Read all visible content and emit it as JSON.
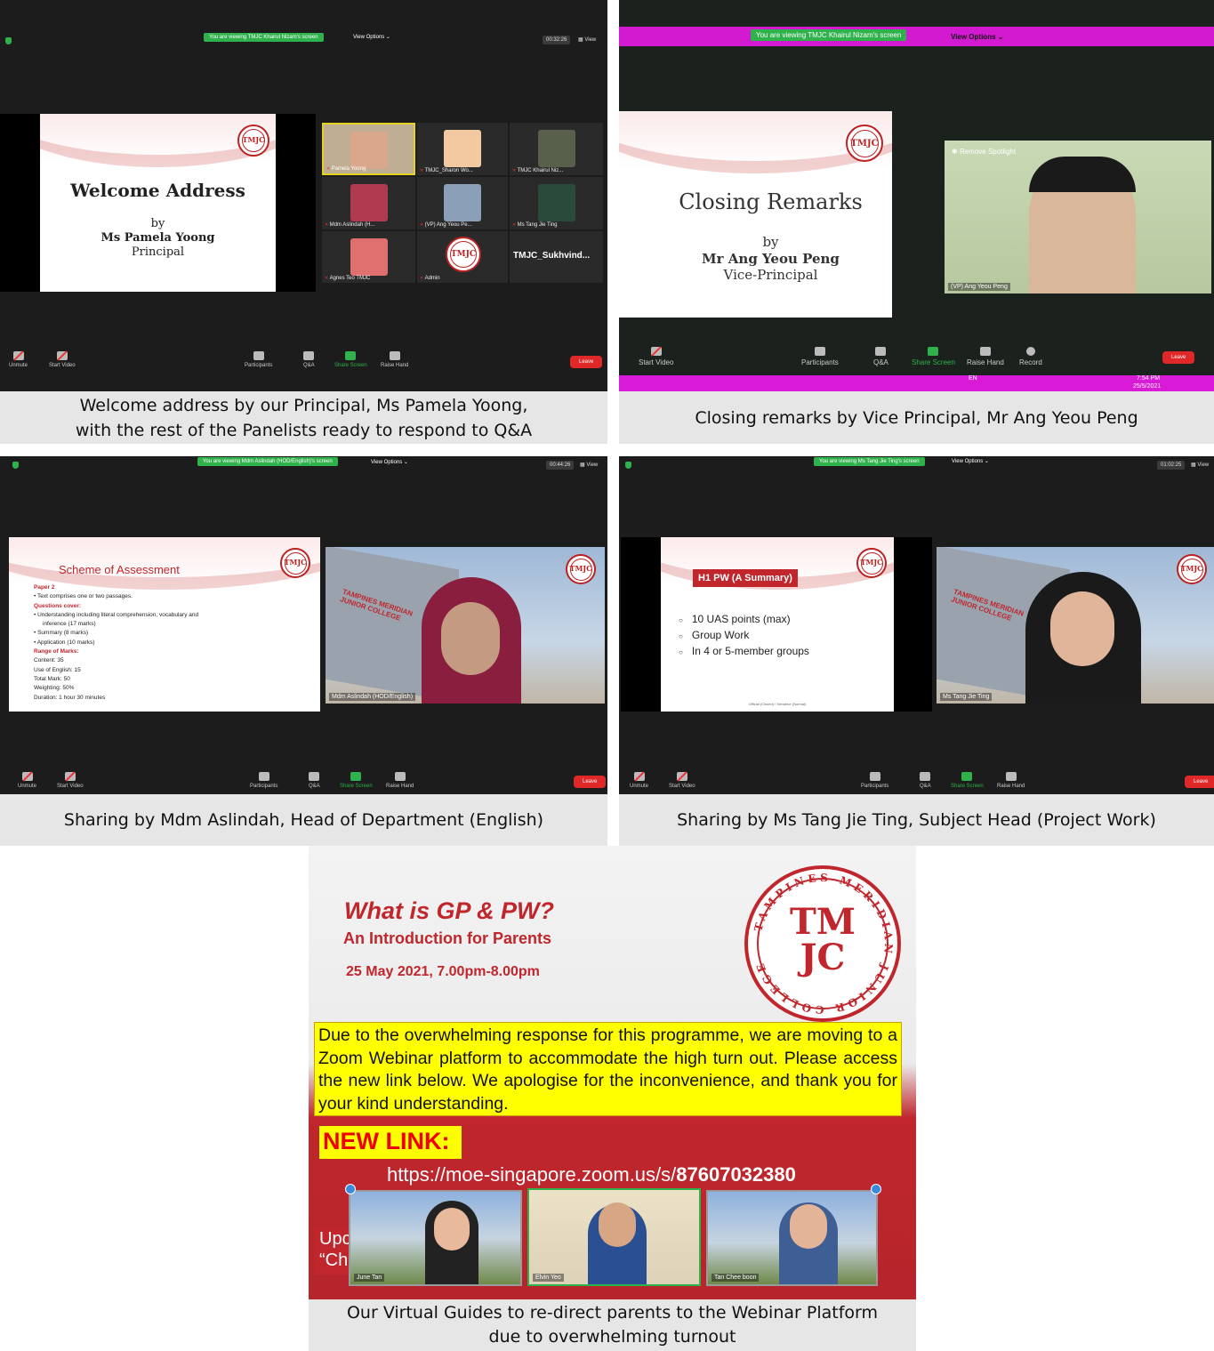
{
  "captions": {
    "p1_line1": "Welcome address by our Principal, Ms Pamela Yoong,",
    "p1_line2": "with the rest of the Panelists ready to respond to Q&A",
    "p2": "Closing remarks by Vice Principal, Mr Ang Yeou Peng",
    "p3": "Sharing by Mdm Aslindah, Head of Department (English)",
    "p4": "Sharing by Ms Tang Jie Ting, Subject Head (Project Work)",
    "p5_line1": "Our Virtual Guides to re-direct parents to the Webinar Platform",
    "p5_line2": "due to overwhelming turnout"
  },
  "zoom_controls": {
    "view_options": "View Options ⌄",
    "view": "View",
    "unmute": "Unmute",
    "start_video": "Start Video",
    "participants": "Participants",
    "qa": "Q&A",
    "share_screen": "Share Screen",
    "raise_hand": "Raise Hand",
    "record": "Record",
    "leave": "Leave",
    "remove_spotlight": "Remove Spotlight"
  },
  "panel1": {
    "viewing": "You are viewing TMJC Khairul Nizam's screen",
    "timer": "00:32:26",
    "slide_title": "Welcome Address",
    "slide_by": "by",
    "slide_name": "Ms Pamela Yoong",
    "slide_role": "Principal",
    "tiles": [
      "Pamela Yoong",
      "TMJC_Sharon Wo...",
      "TMJC Khairul Niz...",
      "Mdm Aslindah (H...",
      "(VP) Ang Yeou Pe...",
      "Ms Tang Jie Ting",
      "Agnes Teo TMJC",
      "Admin",
      "TMJC_Sukhvind..."
    ]
  },
  "panel2": {
    "viewing": "You are viewing TMJC Khairul Nizam's screen",
    "slide_title": "Closing Remarks",
    "slide_by": "by",
    "slide_name": "Mr Ang Yeou Peng",
    "slide_role": "Vice-Principal",
    "video_label": "(VP) Ang Yeou Peng",
    "clock_time": "7:54 PM",
    "clock_date": "25/5/2021",
    "lang": "EN"
  },
  "panel3": {
    "viewing": "You are viewing Mdm Aslindah (HOD/English)'s screen",
    "timer": "00:44:26",
    "slide_title": "Scheme of Assessment",
    "lines": [
      {
        "t": "Paper 2",
        "red": true,
        "bullet": false
      },
      {
        "t": "Text comprises one or two passages.",
        "red": false,
        "bullet": true
      },
      {
        "t": "Questions cover:",
        "red": true,
        "bullet": false
      },
      {
        "t": "Understanding including literal comprehension, vocabulary and",
        "red": false,
        "bullet": true
      },
      {
        "t": "inference (17 marks)",
        "red": false,
        "bullet": false,
        "indent": true
      },
      {
        "t": "Summary (8 marks)",
        "red": false,
        "bullet": true
      },
      {
        "t": "Application (10 marks)",
        "red": false,
        "bullet": true
      },
      {
        "t": "Range of Marks:",
        "red": true,
        "bullet": false
      },
      {
        "t": "Content: 35",
        "red": false,
        "bullet": false
      },
      {
        "t": "Use of English: 15",
        "red": false,
        "bullet": false
      },
      {
        "t": "Total Mark: 50",
        "red": false,
        "bullet": false
      },
      {
        "t": "Weighting: 50%",
        "red": false,
        "bullet": false
      },
      {
        "t": "Duration: 1 hour 30 minutes",
        "red": false,
        "bullet": false
      }
    ],
    "video_label": "Mdm Aslindah (HOD/English)",
    "building_sign1": "TAMPINES MERIDIAN",
    "building_sign2": "JUNIOR COLLEGE"
  },
  "panel4": {
    "viewing": "You are viewing Ms Tang Jie Ting's screen",
    "timer": "01:02:25",
    "slide_title": "H1 PW (A Summary)",
    "items": [
      "10 UAS points (max)",
      "Group Work",
      "In 4 or 5-member groups"
    ],
    "footer": "Official (Closed) \\ Sensitive (Normal)",
    "video_label": "Ms Tang Jie Ting",
    "building_sign1": "TAMPINES MERIDIAN",
    "building_sign2": "JUNIOR COLLEGE"
  },
  "panel5": {
    "title": "What is GP & PW?",
    "subtitle": "An Introduction for Parents",
    "date": "25 May 2021, 7.00pm-8.00pm",
    "notice": "Due to the overwhelming response for this programme, we are moving to a Zoom Webinar platform to accommodate the high turn out. Please access the new link below. We apologise for the inconvenience, and thank you for your kind understanding.",
    "new_link_label": "NEW LINK:",
    "link_prefix": "https://moe-singapore.zoom.us/s/",
    "link_id": "87607032380",
    "partial_left1": "Upc",
    "partial_left2": "“Ch",
    "guides": [
      "June Tan",
      "Elvin Yeo",
      "Tan Chee boon"
    ],
    "logo_letters": "TMJC",
    "logo_ring": "TAMPINES MERIDIAN JUNIOR COLLEGE"
  },
  "logo": {
    "t1": "TM",
    "t2": "JC"
  },
  "colors": {
    "zoom_green": "#2fb14b",
    "leave_red": "#e02828",
    "tmjc_red": "#c0262c",
    "banner_yellow": "#ffff00"
  }
}
